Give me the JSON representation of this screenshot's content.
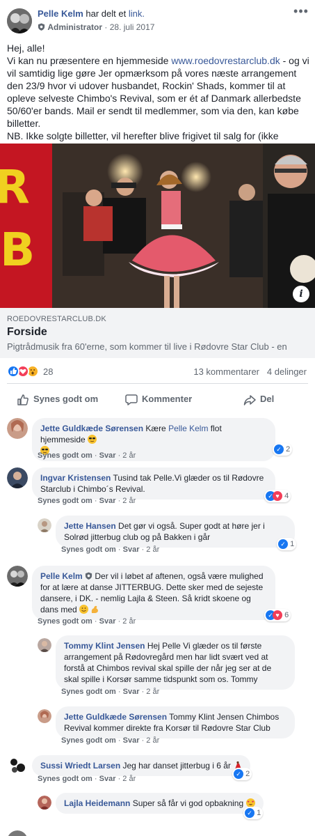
{
  "post": {
    "author": "Pelle Kelm",
    "shared_text": "har delt et",
    "shared_link_word": "link.",
    "role": "Administrator",
    "date": "28. juli 2017",
    "more": "•••",
    "text": {
      "greeting": "Hej, alle!",
      "p1_a": "Vi kan nu præsentere en hjemmeside",
      "p1_url": "www.roedovrestarclub.dk",
      "p1_b": "- og vi vil samtidig lige gøre Jer opmærksom på vores næste arrangement den 23/9 hvor vi udover husbandet, Rockin' Shads, kommer til at opleve selveste Chimbo's Revival, som er ét af Danmark allerbedste 50/60'er bands. Mail er sendt til medlemmer, som via den, kan købe billetter.",
      "p2": "NB. Ikke solgte billetter, vil herefter blive frigivet til salg for (ikke medlemmer)."
    }
  },
  "link_preview": {
    "info_icon": "i",
    "domain": "ROEDOVRESTARCLUB.DK",
    "title": "Forside",
    "description": "Pigtrådmusik fra 60'erne, som kommer til live i Rødovre Star Club - en"
  },
  "stats": {
    "reaction_count": "28",
    "comments": "13 kommentarer",
    "shares": "4 delinger"
  },
  "actions": {
    "like": "Synes godt om",
    "comment": "Kommenter",
    "share": "Del"
  },
  "comment_actions": {
    "like": "Synes godt om",
    "sep": "·",
    "reply": "Svar",
    "age": "2 år"
  },
  "comments": [
    {
      "author": "Jette Guldkæde Sørensen",
      "mention": "Pelle Kelm",
      "text_before": "Kære",
      "text_after": "flot hjemmeside",
      "reactions": "2"
    },
    {
      "author": "Ingvar Kristensen",
      "text": "Tusind tak Pelle.Vi glæder os til Rødovre Starclub i Chimbo´s Revival.",
      "reactions": "4"
    },
    {
      "author": "Jette Hansen",
      "text": "Det gør vi også. Super godt at høre jer i Solrød jitterbug club og på Bakken i går",
      "reactions": "1"
    },
    {
      "author": "Pelle Kelm",
      "text": "Der vil i løbet af aftenen, også være mulighed for at lære at danse JITTERBUG. Dette sker med de sejeste dansere, i DK. - nemlig Lajla & Steen. Så kridt skoene og dans med",
      "reactions": "6"
    },
    {
      "author": "Tommy Klint Jensen",
      "text": "Hej Pelle Vi glæder os til første arrangement på Rødovregård men har lidt svært ved at forstå at Chimbos revival skal spille der når jeg ser at de skal spille i Korsør samme tidspunkt som os. Tommy"
    },
    {
      "author": "Jette Guldkæde Sørensen",
      "text": "Tommy Klint Jensen Chimbos Revival kommer direkte fra Korsør til Rødovre Star Club"
    },
    {
      "author": "Sussi Wriedt Larsen",
      "text": "Jeg har danset jitterbug i 6 år",
      "reactions": "2"
    },
    {
      "author": "Lajla Heidemann",
      "text": "Super så får vi god opbakning",
      "reactions": "1"
    }
  ],
  "colors": {
    "link_blue": "#385898",
    "like_blue": "#1877f2",
    "love_red": "#f33e58",
    "wow_yellow": "#f7b125",
    "bubble_bg": "#f2f3f5",
    "meta_gray": "#606770"
  }
}
